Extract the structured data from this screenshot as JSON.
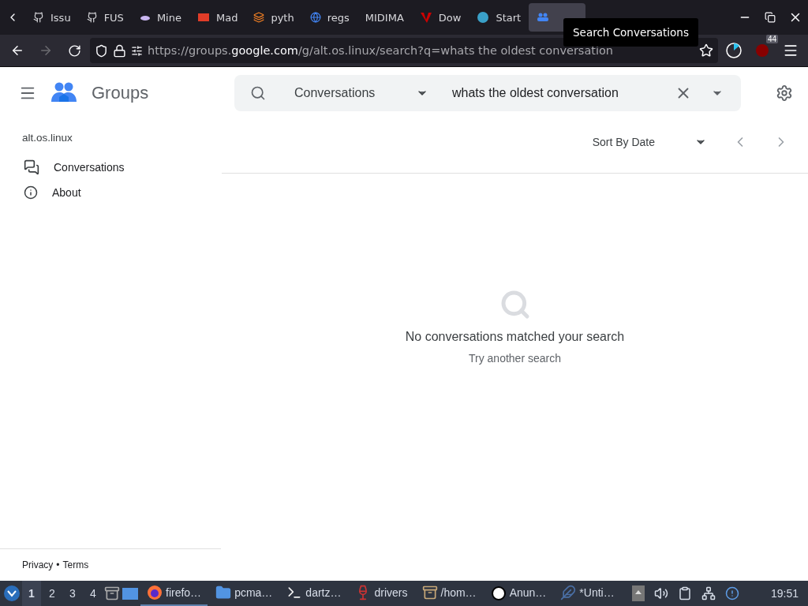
{
  "browser": {
    "tabs": [
      {
        "label": "Issu",
        "selected": false
      },
      {
        "label": "FUS",
        "selected": false
      },
      {
        "label": "Mine",
        "selected": false
      },
      {
        "label": "Mad",
        "selected": false
      },
      {
        "label": "pyth",
        "selected": false
      },
      {
        "label": "regs",
        "selected": false
      },
      {
        "label": "MIDIMA",
        "selected": false
      },
      {
        "label": "Dow",
        "selected": false
      },
      {
        "label": "Start",
        "selected": false
      },
      {
        "selected": true
      }
    ],
    "tooltip": "Search Conversations",
    "url": {
      "prefix": "https://groups.",
      "domain": "google.com",
      "path": "/g/alt.os.linux/search?q=whats the oldest conversation"
    },
    "extension_badge": "44"
  },
  "app": {
    "name": "Groups",
    "group": "alt.os.linux",
    "nav": [
      {
        "label": "Conversations"
      },
      {
        "label": "About"
      }
    ],
    "footer_links": [
      "Privacy",
      "Terms"
    ],
    "footer_separator": "•",
    "search": {
      "scope": "Conversations",
      "query": "whats the oldest conversation"
    },
    "sort": "Sort By Date",
    "empty": {
      "title": "No conversations matched your search",
      "hint": "Try another search"
    }
  },
  "taskbar": {
    "workspaces": [
      {
        "label": "1",
        "selected": true
      },
      {
        "label": "2",
        "selected": false
      },
      {
        "label": "3",
        "selected": false
      },
      {
        "label": "4",
        "selected": false
      }
    ],
    "tasks": [
      {
        "label": "firefo…",
        "selected": true
      },
      {
        "label": "pcma…",
        "selected": false
      },
      {
        "label": "dartz…",
        "selected": false
      },
      {
        "label": "drivers",
        "selected": false
      },
      {
        "label": "/hom…",
        "selected": false
      },
      {
        "label": "Anun…",
        "selected": false
      },
      {
        "label": "*Unti…",
        "selected": false
      }
    ],
    "clock": "19:51"
  }
}
